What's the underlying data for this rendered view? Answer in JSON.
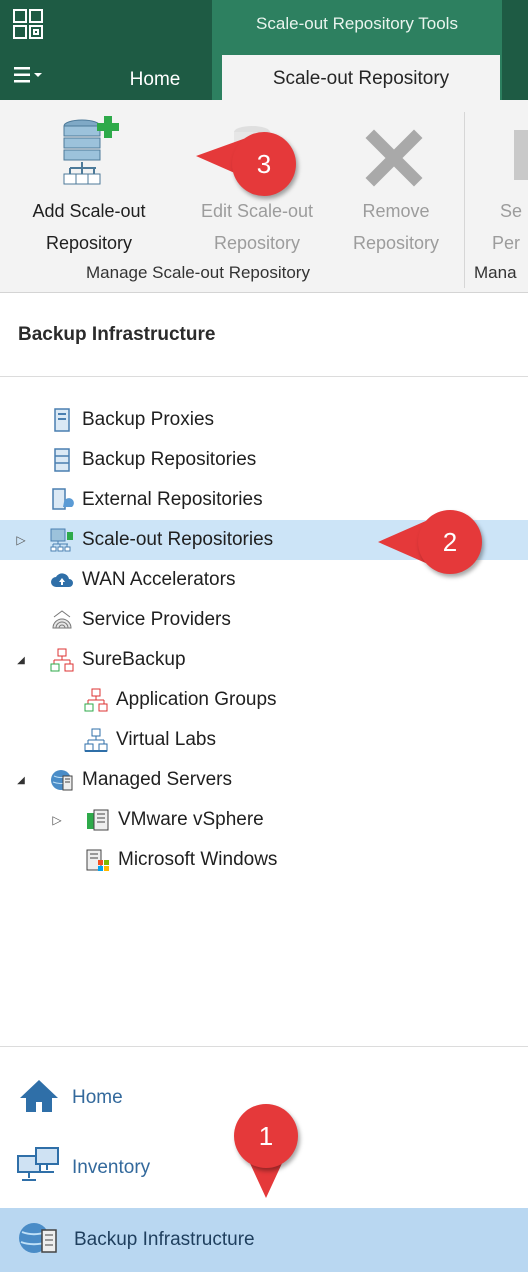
{
  "header": {
    "contextual_group": "Scale-out Repository Tools",
    "tabs": [
      {
        "label": "Home"
      },
      {
        "label": "Scale-out Repository"
      }
    ],
    "menu_icon": "hamburger-menu-icon",
    "colors": {
      "titlebar": "#1e5b44",
      "contextual": "#2d8060",
      "ribbon": "#f3f3f3"
    }
  },
  "ribbon": {
    "buttons": [
      {
        "line1": "Add Scale-out",
        "line2": "Repository",
        "icon": "add-repository-icon",
        "enabled": true
      },
      {
        "line1": "Edit Scale-out",
        "line2": "Repository",
        "icon": "edit-repository-icon",
        "enabled": false
      },
      {
        "line1": "Remove",
        "line2": "Repository",
        "icon": "remove-x-icon",
        "enabled": false
      },
      {
        "line1": "Se",
        "line2": "Per",
        "icon": "settings-icon",
        "enabled": false
      }
    ],
    "groups": [
      {
        "label": "Manage  Scale-out Repository"
      },
      {
        "label": "Mana"
      }
    ]
  },
  "pane": {
    "title": "Backup Infrastructure",
    "tree": [
      {
        "label": "Backup Proxies",
        "icon": "proxy-server-icon",
        "level": 1
      },
      {
        "label": "Backup Repositories",
        "icon": "repository-icon",
        "level": 1
      },
      {
        "label": "External Repositories",
        "icon": "external-repository-icon",
        "level": 1
      },
      {
        "label": "Scale-out Repositories",
        "icon": "scale-out-repository-icon",
        "level": 1,
        "selected": true,
        "expander": "▷"
      },
      {
        "label": "WAN Accelerators",
        "icon": "cloud-icon",
        "level": 1
      },
      {
        "label": "Service Providers",
        "icon": "service-provider-icon",
        "level": 1
      },
      {
        "label": "SureBackup",
        "icon": "surebackup-icon",
        "level": 1,
        "expander": "◢"
      },
      {
        "label": "Application Groups",
        "icon": "application-group-icon",
        "level": 2
      },
      {
        "label": "Virtual Labs",
        "icon": "virtual-lab-icon",
        "level": 2
      },
      {
        "label": "Managed Servers",
        "icon": "managed-servers-icon",
        "level": 1,
        "expander": "◢"
      },
      {
        "label": "VMware vSphere",
        "icon": "vsphere-icon",
        "level": 2,
        "expander": "▷"
      },
      {
        "label": "Microsoft Windows",
        "icon": "windows-icon",
        "level": 2
      }
    ]
  },
  "bottom_nav": [
    {
      "label": "Home",
      "icon": "home-icon"
    },
    {
      "label": "Inventory",
      "icon": "inventory-icon"
    },
    {
      "label": "Backup Infrastructure",
      "icon": "backup-infrastructure-icon",
      "selected": true
    }
  ],
  "callouts": [
    {
      "number": "3"
    },
    {
      "number": "2"
    },
    {
      "number": "1"
    }
  ]
}
